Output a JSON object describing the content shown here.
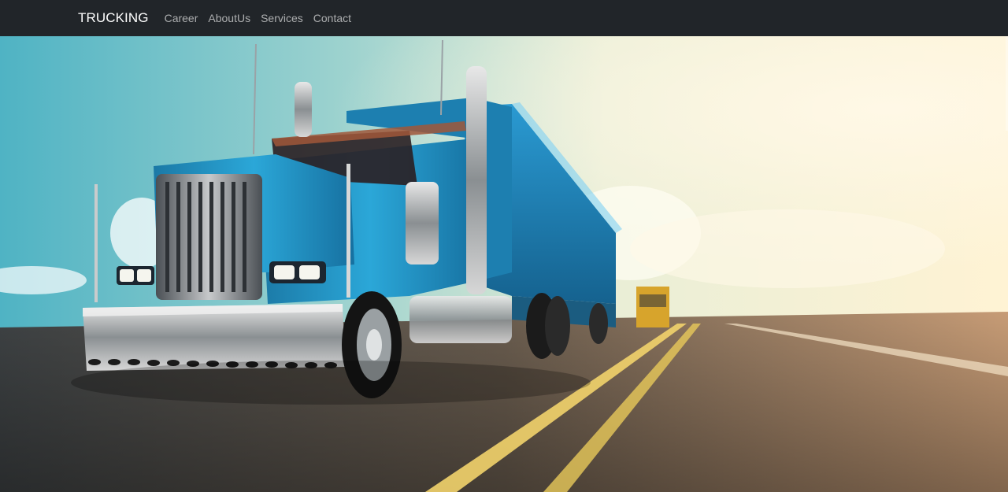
{
  "navbar": {
    "brand": "TRUCKING",
    "links": [
      {
        "label": "Career"
      },
      {
        "label": "AboutUs"
      },
      {
        "label": "Services"
      },
      {
        "label": "Contact"
      }
    ]
  },
  "hero": {
    "image_icon": "truck-on-highway-photo"
  },
  "colors": {
    "navbar_bg": "#212529",
    "brand_text": "#ffffff",
    "link_text": "#9b9d9f",
    "truck_blue": "#1f86b8",
    "road_line": "#f2d36b"
  }
}
